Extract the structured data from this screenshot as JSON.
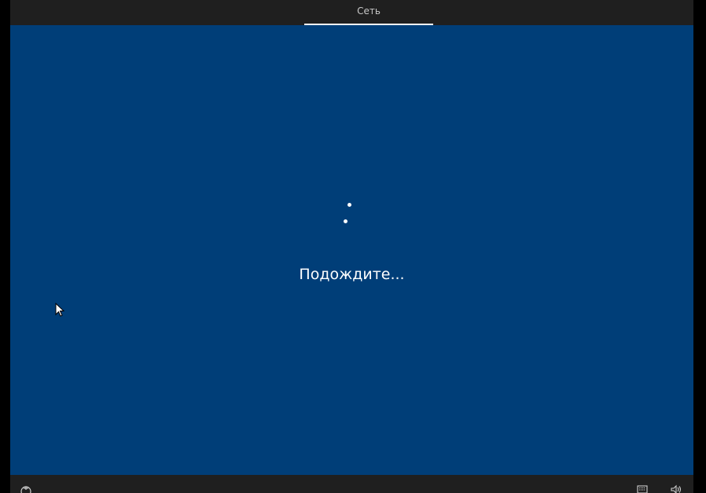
{
  "top_bar": {
    "tabs": [
      {
        "label": "Сеть",
        "active": true
      }
    ]
  },
  "main": {
    "status_text": "Подождите...",
    "background_color": "#003e78",
    "spinner": "loading-dots"
  },
  "bottom_bar": {
    "left_icons": [
      "accessibility-icon"
    ],
    "right_icons": [
      "keyboard-icon",
      "volume-icon"
    ]
  }
}
